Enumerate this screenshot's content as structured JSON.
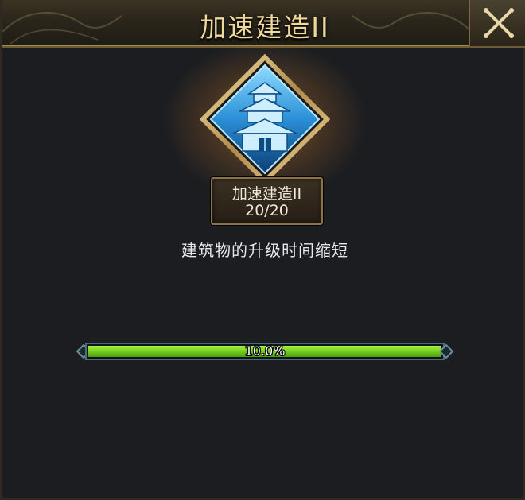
{
  "header": {
    "title": "加速建造II"
  },
  "skill": {
    "name": "加速建造II",
    "level_text": "20/20",
    "description": "建筑物的升级时间缩短",
    "icon": "pagoda-building-icon",
    "frame_color": "#c9a86a",
    "icon_color": "#3aa6e8"
  },
  "progress": {
    "label": "10.0%",
    "fill_fraction": 1.0,
    "color": "#7ad31f"
  }
}
